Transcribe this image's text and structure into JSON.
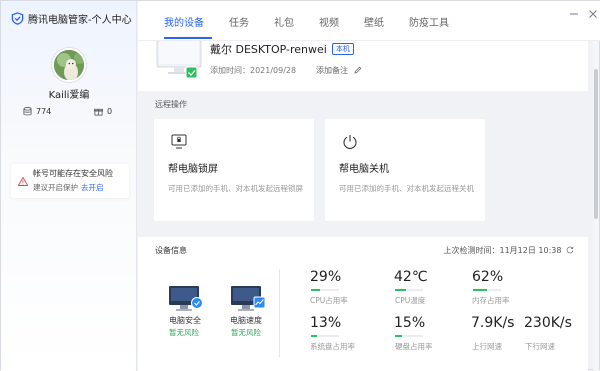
{
  "app": {
    "title": "腾讯电脑管家-个人中心"
  },
  "sidebar": {
    "username": "Kaili爱编",
    "storage_count": "774",
    "gift_count": "0",
    "risk": {
      "title": "帐号可能存在安全风险",
      "subtitle": "建议开启保护",
      "link": "去开启"
    }
  },
  "nav": {
    "tabs": [
      {
        "label": "我的设备",
        "active": true
      },
      {
        "label": "任务",
        "active": false
      },
      {
        "label": "礼包",
        "active": false
      },
      {
        "label": "视频",
        "active": false
      },
      {
        "label": "壁纸",
        "active": false
      },
      {
        "label": "防疫工具",
        "active": false
      }
    ]
  },
  "device": {
    "name": "戴尔 DESKTOP-renwei",
    "badge": "本机",
    "added_time": "添加时间：2021/09/28",
    "add_note": "添加备注"
  },
  "remote": {
    "section_label": "远程操作",
    "ops": [
      {
        "title": "帮电脑锁屏",
        "desc": "可用已添加的手机、对本机发起远程锁屏"
      },
      {
        "title": "帮电脑关机",
        "desc": "可用已添加的手机、对本机发起远程关机"
      }
    ]
  },
  "info": {
    "section_label": "设备信息",
    "last_check": "上次检测时间：11月12日 10:38",
    "devices": [
      {
        "title": "电脑安全",
        "status": "暂无风险"
      },
      {
        "title": "电脑速度",
        "status": "暂无风险"
      }
    ],
    "metrics": [
      {
        "value": "29%",
        "label": "CPU占用率",
        "fill": 0.29
      },
      {
        "value": "42℃",
        "label": "CPU温度",
        "fill": 0.42
      },
      {
        "value": "62%",
        "label": "内存占用率",
        "fill": 0.62
      },
      {
        "value": "13%",
        "label": "系统盘占用率",
        "fill": 0.13
      },
      {
        "value": "15%",
        "label": "硬盘占用率",
        "fill": 0.15
      },
      {
        "value": "7.9K/s",
        "label": "上行网速",
        "fill": null
      },
      {
        "value": "230K/s",
        "label": "下行网速",
        "fill": null
      }
    ]
  },
  "colors": {
    "accent": "#2a64f6",
    "ok": "#2fa85a",
    "bar": "#2fbf5e",
    "warn": "#e04848"
  }
}
